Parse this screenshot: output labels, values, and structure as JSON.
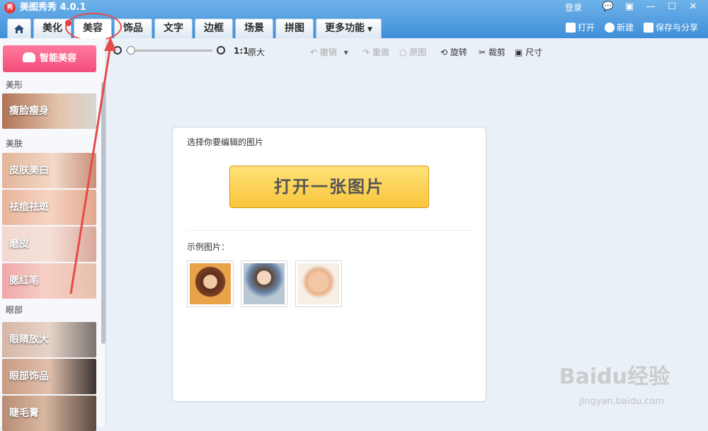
{
  "app": {
    "title": "美图秀秀 4.0.1",
    "logo_text": "秀"
  },
  "window": {
    "login": "登录",
    "controls": [
      "💬",
      "▣",
      "—",
      "☐",
      "✕"
    ]
  },
  "tabs": [
    {
      "label": "美化"
    },
    {
      "label": "美容",
      "active": true
    },
    {
      "label": "饰品"
    },
    {
      "label": "文字"
    },
    {
      "label": "边框"
    },
    {
      "label": "场景"
    },
    {
      "label": "拼图"
    },
    {
      "label": "更多功能"
    }
  ],
  "file_actions": {
    "open": "打开",
    "new": "新建",
    "save_share": "保存与分享"
  },
  "sidebar": {
    "smart_beauty": "智能美容",
    "sections": {
      "shape": "美形",
      "skin": "美肤",
      "eyes": "眼部"
    },
    "features": {
      "slim": "瘦脸瘦身",
      "whiten": "皮肤美白",
      "acne": "祛痘祛斑",
      "smooth": "磨皮",
      "blush": "腮红笔",
      "eye_enlarge": "眼睛放大",
      "eye_accessory": "眼部饰品",
      "mascara": "睫毛膏"
    }
  },
  "toolbar": {
    "ratio": "1:1",
    "original_size": "原大",
    "undo": "撤销",
    "redo": "重做",
    "original": "原图",
    "rotate": "旋转",
    "crop": "裁剪",
    "size": "尺寸"
  },
  "panel": {
    "title": "选择你要编辑的图片",
    "open_button": "打开一张图片",
    "samples_label": "示例图片："
  },
  "watermark": {
    "main": "Baidu经验",
    "sub": "jingyan.baidu.com"
  },
  "colors": {
    "title_bar": "#4a97dc",
    "smart_button": "#f24d7a",
    "open_button": "#f8c53a",
    "annotation": "#e84a4a"
  }
}
